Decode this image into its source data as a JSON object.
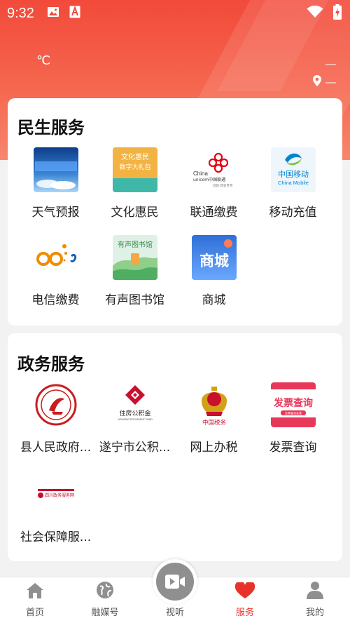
{
  "status_bar": {
    "time": "9:32"
  },
  "weather": {
    "temp_unit": "℃",
    "value": "—",
    "location": "—"
  },
  "colors": {
    "accent": "#e8332a",
    "header": "#f24a3a",
    "icon_gray": "#8f8f8f"
  },
  "sections": {
    "minsheng": {
      "title": "民生服务",
      "items": [
        {
          "label": "天气预报",
          "icon": "weather-thumb"
        },
        {
          "label": "文化惠民",
          "icon": "culture-thumb",
          "thumb_text_1": "文化惠民",
          "thumb_text_2": "数字大礼包"
        },
        {
          "label": "联通缴费",
          "icon": "china-unicom-logo",
          "logo_text_1": "China",
          "logo_text_2": "unicom中国联通",
          "logo_text_3": "创新·改变世界"
        },
        {
          "label": "移动充值",
          "icon": "china-mobile-logo",
          "logo_text_1": "中国移动",
          "logo_text_2": "China Mobile"
        },
        {
          "label": "电信缴费",
          "icon": "china-telecom-logo"
        },
        {
          "label": "有声图书馆",
          "icon": "audio-library-thumb",
          "thumb_text": "有声图书馆"
        },
        {
          "label": "商城",
          "icon": "mall-thumb",
          "thumb_text": "商城"
        }
      ]
    },
    "zhengwu": {
      "title": "政务服务",
      "items": [
        {
          "label": "县人民政府...",
          "icon": "county-gov-emblem"
        },
        {
          "label": "遂宁市公积...",
          "icon": "housing-fund-logo",
          "logo_text_1": "住房公积金",
          "logo_text_2": "HOUSING PROVIDENT FUND"
        },
        {
          "label": "网上办税",
          "icon": "tax-emblem",
          "logo_text": "中国税务"
        },
        {
          "label": "发票查询",
          "icon": "invoice-query-thumb",
          "thumb_text": "发票查询",
          "thumb_sub": "发票查询系统"
        },
        {
          "label": "社会保障服...",
          "icon": "sichuan-gov-service-logo",
          "logo_text": "四川政务服务网"
        }
      ]
    }
  },
  "tabbar": {
    "items": [
      {
        "label": "首页",
        "icon": "home-icon"
      },
      {
        "label": "融媒号",
        "icon": "globe-icon"
      },
      {
        "label": "视听",
        "icon": "video-icon"
      },
      {
        "label": "服务",
        "icon": "heart-icon",
        "active": true
      },
      {
        "label": "我的",
        "icon": "user-icon"
      }
    ]
  }
}
